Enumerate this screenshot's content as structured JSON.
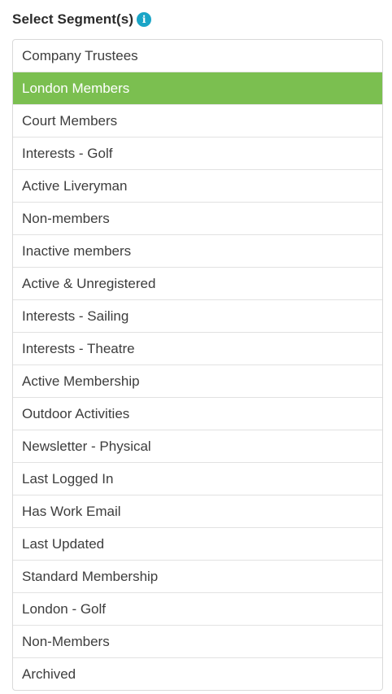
{
  "header": {
    "title": "Select Segment(s)",
    "info_icon": "info-icon",
    "info_glyph": "i",
    "info_color": "#1aa5c7"
  },
  "segments": {
    "selected_color": "#7bbf50",
    "items": [
      {
        "label": "Company Trustees",
        "selected": false
      },
      {
        "label": "London Members",
        "selected": true
      },
      {
        "label": "Court Members",
        "selected": false
      },
      {
        "label": "Interests - Golf",
        "selected": false
      },
      {
        "label": "Active Liveryman",
        "selected": false
      },
      {
        "label": "Non-members",
        "selected": false
      },
      {
        "label": "Inactive members",
        "selected": false
      },
      {
        "label": "Active & Unregistered",
        "selected": false
      },
      {
        "label": "Interests - Sailing",
        "selected": false
      },
      {
        "label": "Interests - Theatre",
        "selected": false
      },
      {
        "label": "Active Membership",
        "selected": false
      },
      {
        "label": "Outdoor Activities",
        "selected": false
      },
      {
        "label": "Newsletter - Physical",
        "selected": false
      },
      {
        "label": "Last Logged In",
        "selected": false
      },
      {
        "label": "Has Work Email",
        "selected": false
      },
      {
        "label": "Last Updated",
        "selected": false
      },
      {
        "label": "Standard Membership",
        "selected": false
      },
      {
        "label": "London - Golf",
        "selected": false
      },
      {
        "label": "Non-Members",
        "selected": false
      },
      {
        "label": "Archived",
        "selected": false
      }
    ]
  }
}
